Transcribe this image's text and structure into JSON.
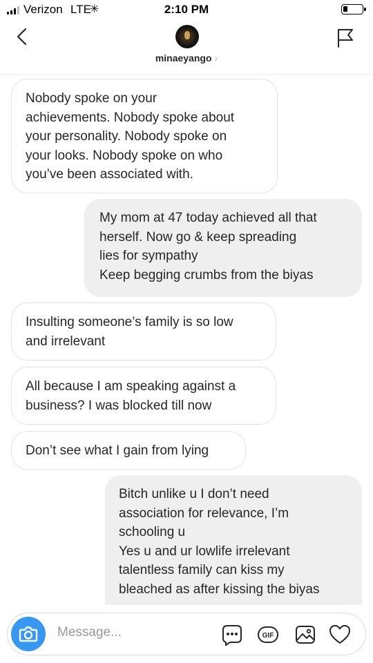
{
  "status_bar": {
    "carrier": "Verizon",
    "network": "LTE",
    "time": "2:10 PM"
  },
  "header": {
    "username": "minaeyango",
    "back_icon": "chevron-left-icon",
    "report_icon": "flag-icon"
  },
  "messages": [
    {
      "direction": "received",
      "lines": [
        "Nobody spoke on your",
        "achievements. Nobody spoke about",
        "your personality. Nobody spoke on",
        "your looks. Nobody spoke on who",
        "you’ve been associated with."
      ]
    },
    {
      "direction": "sent",
      "lines": [
        "My mom at 47 today achieved all that",
        "herself. Now go & keep spreading",
        "lies for sympathy",
        "Keep begging crumbs from the biyas"
      ]
    },
    {
      "direction": "received",
      "lines": [
        "Insulting someone’s family is so low",
        "and irrelevant"
      ]
    },
    {
      "direction": "received",
      "lines": [
        "All because I am speaking against a",
        "business? I was blocked till now"
      ]
    },
    {
      "direction": "received",
      "lines": [
        "Don’t see what I gain from lying"
      ]
    },
    {
      "direction": "sent",
      "lines": [
        "Bitch unlike u I don’t need",
        "association for relevance, I’m",
        "schooling u",
        "Yes u and ur lowlife irrelevant",
        "talentless family can kiss my",
        "bleached as after kissing the biyas"
      ]
    }
  ],
  "composer": {
    "placeholder": "Message...",
    "camera_icon": "camera-icon",
    "more_icon": "more-icon",
    "gif_label": "GIF",
    "gallery_icon": "image-icon",
    "heart_icon": "heart-icon"
  },
  "colors": {
    "accent": "#3897f0",
    "sent_bubble": "#efefef",
    "received_border": "#e3e3e3",
    "text": "#262626"
  }
}
